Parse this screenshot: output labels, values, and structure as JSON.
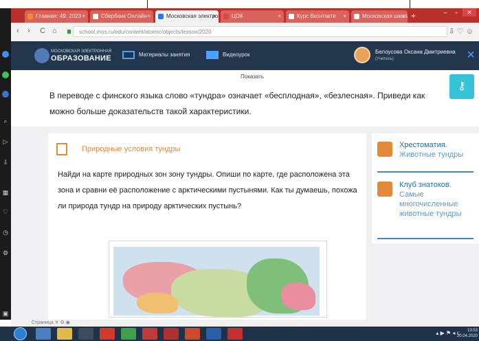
{
  "browser": {
    "tabs": [
      {
        "label": "Главная: 49. 2023",
        "fav": "#f28c28",
        "active": false
      },
      {
        "label": "Сбербанк Онлайн",
        "fav": "#ffffff",
        "active": false
      },
      {
        "label": "Московская электронная",
        "fav": "#2b7bd6",
        "active": true
      },
      {
        "label": "ЦОК",
        "fav": "#e04343",
        "active": false
      },
      {
        "label": "Курс Вконтакте",
        "fav": "#ffffff",
        "active": false
      },
      {
        "label": "Московская школа",
        "fav": "#ffffff",
        "active": false
      }
    ],
    "new_tab": "+",
    "url": "school.mos.ru/edu/content/atomic/objects/lesson/2020",
    "nav": {
      "back": "‹",
      "forward": "›",
      "reload": "C",
      "home": "⌂"
    }
  },
  "site": {
    "logo_small": "МОСКОВСКАЯ ЭЛЕКТРОННАЯ",
    "logo_big": "ОБРАЗОВАНИЕ",
    "nav_materials": "Материалы занятия",
    "nav_video": "Видеоурок",
    "user_name": "Белоусова Оксана Дмитриевна",
    "user_role": "(Учитель)",
    "close": "×"
  },
  "task": {
    "show_label": "Показать",
    "text": "В переводе с финского языка слово «тундра» означает «бесплодная», «безлесная». Приведи как можно больше доказательств такой характеристики."
  },
  "card": {
    "title": "Природные условия тундры",
    "text": "Найди на карте природных зон зону тундры. Опиши по карте, где расположена эта зона и сравни её расположение с арктическими пустынями. Как ты думаешь, похожа ли природа тундр на природу арктических пустынь?"
  },
  "side": {
    "item1_title": "Хрестоматия.",
    "item1_sub": "Животные тундры",
    "item2_title": "Клуб знатоков.",
    "item2_sub": "Самые многочисленные животные тундры"
  },
  "statusbar": {
    "text": "Страница  ✕  ⚙  ◉"
  },
  "taskbar": {
    "apps": [
      {
        "name": "explorer-app",
        "color": "#4a7fc0"
      },
      {
        "name": "folder-app",
        "color": "#e3b94a"
      },
      {
        "name": "media-app",
        "color": "#3d4b5c"
      },
      {
        "name": "opera-app",
        "color": "#d23a2c"
      },
      {
        "name": "chrome-app",
        "color": "#3fa04a"
      },
      {
        "name": "flag-app",
        "color": "#c33a3a"
      },
      {
        "name": "pdf-app",
        "color": "#b03030"
      },
      {
        "name": "ppt-app",
        "color": "#d04a2a"
      },
      {
        "name": "word-app",
        "color": "#2b5faa"
      },
      {
        "name": "acrobat-app",
        "color": "#c43030"
      }
    ],
    "tray": "▴ ▶ ⚑ ◂ ⅽ",
    "time": "13:53",
    "date": "20.04.2020"
  }
}
